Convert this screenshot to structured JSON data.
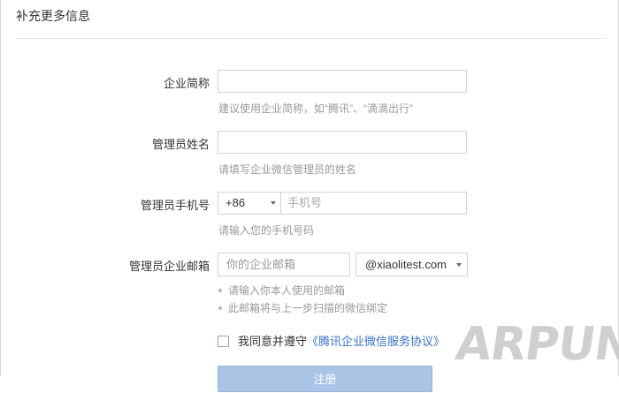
{
  "page": {
    "title": "补充更多信息"
  },
  "form": {
    "company_short_name": {
      "label": "企业简称",
      "value": "",
      "hint": "建议使用企业简称，如“腾讯”、“滴滴出行”"
    },
    "admin_name": {
      "label": "管理员姓名",
      "value": "",
      "hint": "请填写企业微信管理员的姓名"
    },
    "admin_phone": {
      "label": "管理员手机号",
      "country_code": "+86",
      "placeholder": "手机号",
      "hint": "请输入您的手机号码"
    },
    "admin_email": {
      "label": "管理员企业邮箱",
      "placeholder": "你的企业邮箱",
      "domain": "@xiaolitest.com",
      "hints": [
        "请输入你本人使用的邮箱",
        "此邮箱将与上一步扫描的微信绑定"
      ]
    },
    "agreement": {
      "prefix": "我同意并遵守",
      "link_text": "《腾讯企业微信服务协议》",
      "checked": false
    },
    "submit_label": "注册"
  },
  "watermark": "ARPUN.COM",
  "colors": {
    "input_border": "#c9d3df",
    "link": "#3a73c4",
    "button_disabled": "#a9c4e4"
  }
}
